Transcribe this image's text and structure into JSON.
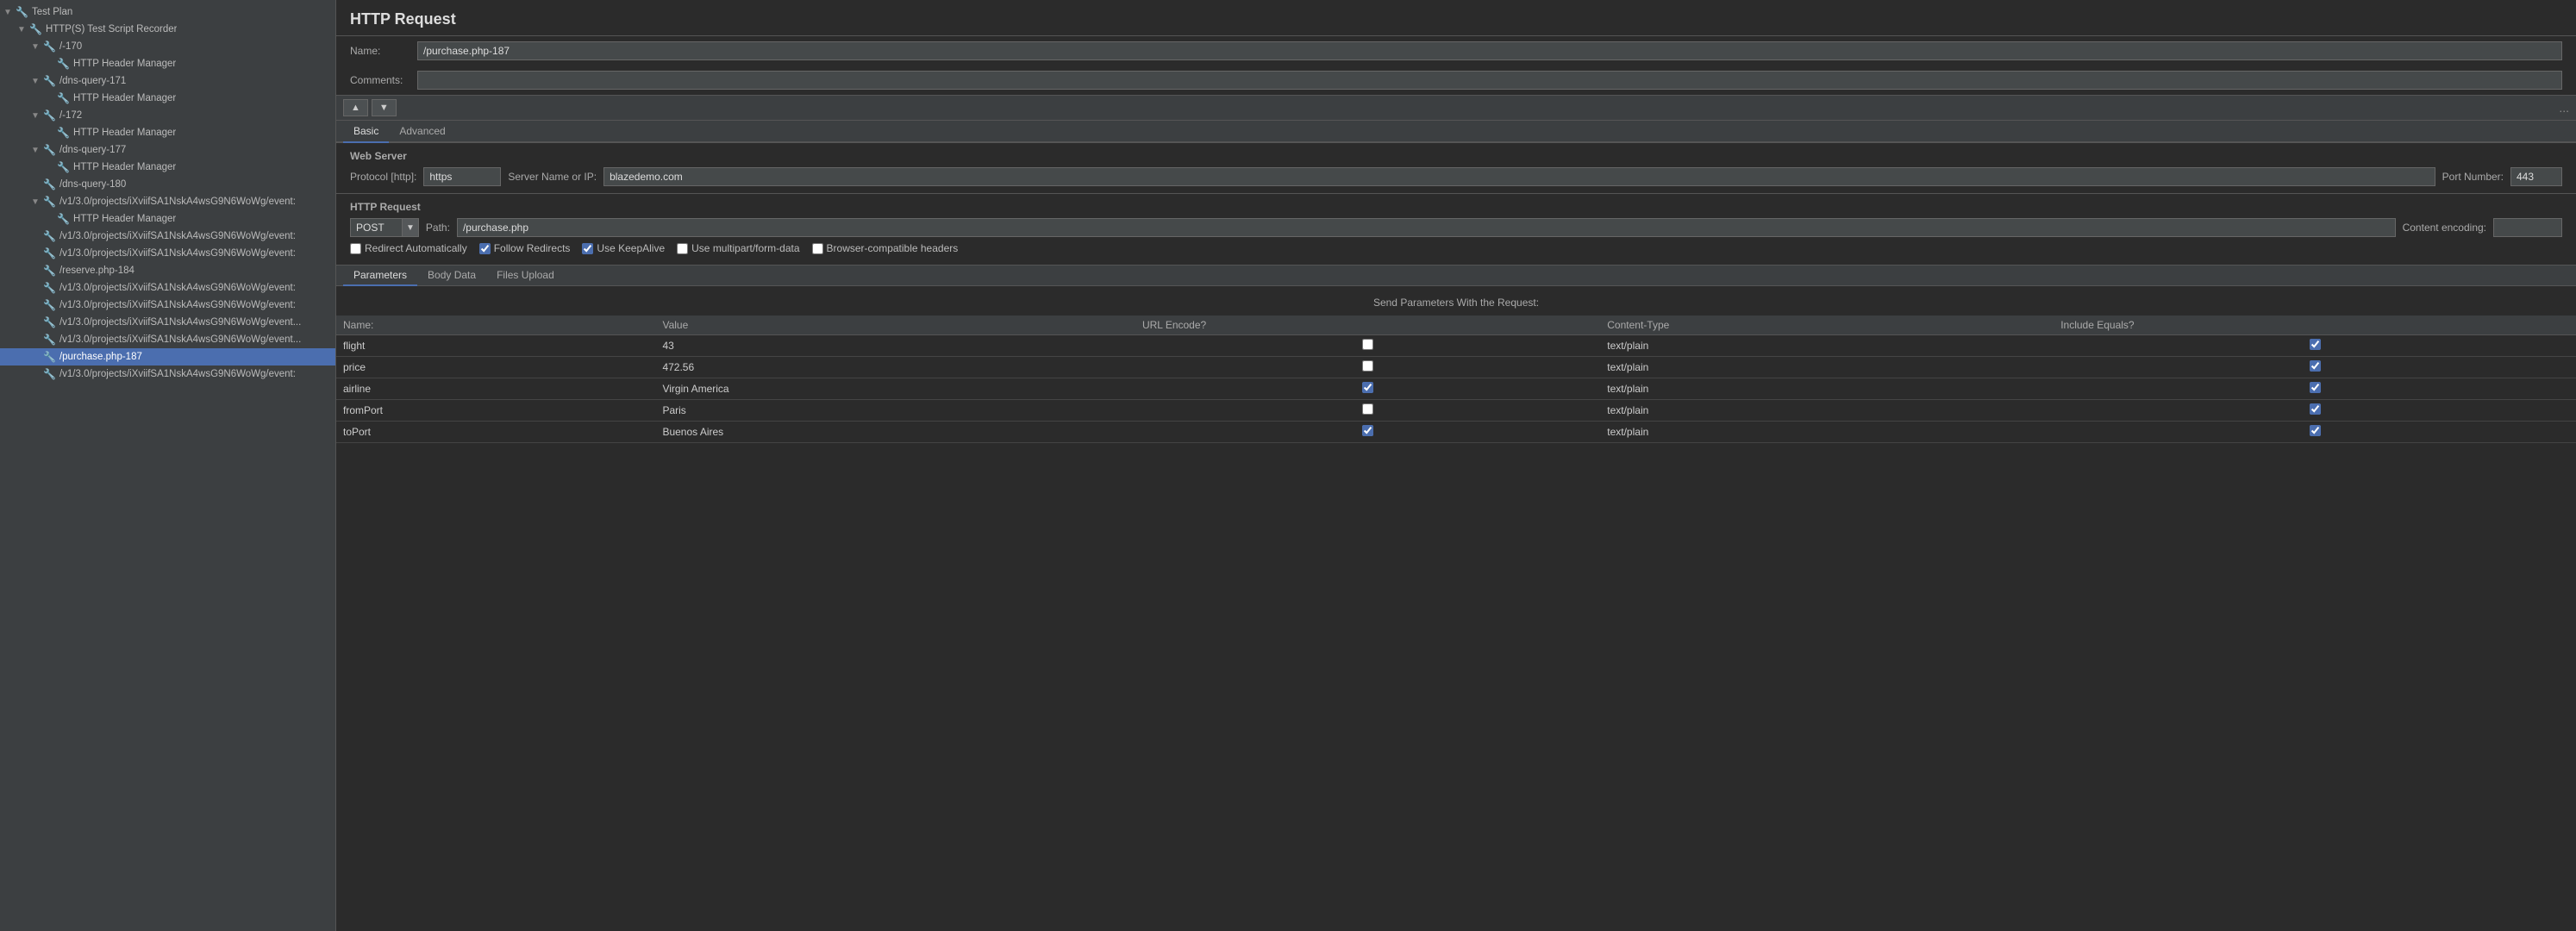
{
  "app": {
    "title": "HTTP Request",
    "name_label": "Name:",
    "comments_label": "Comments:",
    "name_value": "/purchase.php-187",
    "comments_value": ""
  },
  "toolbar": {
    "up_arrow": "▲",
    "down_arrow": "▼",
    "dots": "..."
  },
  "tabs": {
    "basic": "Basic",
    "advanced": "Advanced"
  },
  "web_server": {
    "title": "Web Server",
    "protocol_label": "Protocol [http]:",
    "protocol_value": "https",
    "server_label": "Server Name or IP:",
    "server_value": "blazedemo.com",
    "port_label": "Port Number:",
    "port_value": "443"
  },
  "http_request_section": {
    "title": "HTTP Request",
    "method": "POST",
    "path_label": "Path:",
    "path_value": "/purchase.php",
    "content_enc_label": "Content encoding:",
    "content_enc_value": ""
  },
  "checkboxes": {
    "redirect_auto_label": "Redirect Automatically",
    "redirect_auto_checked": false,
    "follow_redirects_label": "Follow Redirects",
    "follow_redirects_checked": true,
    "keepalive_label": "Use KeepAlive",
    "keepalive_checked": true,
    "multipart_label": "Use multipart/form-data",
    "multipart_checked": false,
    "browser_compat_label": "Browser-compatible headers",
    "browser_compat_checked": false
  },
  "sub_tabs": {
    "parameters": "Parameters",
    "body_data": "Body Data",
    "files_upload": "Files Upload"
  },
  "params_section": {
    "header": "Send Parameters With the Request:",
    "columns": {
      "name": "Name:",
      "value": "Value",
      "url_encode": "URL Encode?",
      "content_type": "Content-Type",
      "include_equals": "Include Equals?"
    },
    "rows": [
      {
        "name": "flight",
        "value": "43",
        "url_encode": false,
        "content_type": "text/plain",
        "include_equals": true
      },
      {
        "name": "price",
        "value": "472.56",
        "url_encode": false,
        "content_type": "text/plain",
        "include_equals": true
      },
      {
        "name": "airline",
        "value": "Virgin America",
        "url_encode": true,
        "content_type": "text/plain",
        "include_equals": true
      },
      {
        "name": "fromPort",
        "value": "Paris",
        "url_encode": false,
        "content_type": "text/plain",
        "include_equals": true
      },
      {
        "name": "toPort",
        "value": "Buenos Aires",
        "url_encode": true,
        "content_type": "text/plain",
        "include_equals": true
      }
    ]
  },
  "sidebar": {
    "items": [
      {
        "id": "test-plan",
        "label": "Test Plan",
        "depth": 0,
        "type": "root",
        "expanded": true,
        "icon": "▲"
      },
      {
        "id": "http-recorder",
        "label": "HTTP(S) Test Script Recorder",
        "depth": 1,
        "type": "recorder",
        "expanded": true,
        "icon": "🔧"
      },
      {
        "id": "item-170",
        "label": "/-170",
        "depth": 2,
        "type": "folder",
        "expanded": true,
        "icon": "🔧"
      },
      {
        "id": "item-170-header",
        "label": "HTTP Header Manager",
        "depth": 3,
        "type": "manager",
        "icon": "🔧"
      },
      {
        "id": "item-dns-171",
        "label": "/dns-query-171",
        "depth": 2,
        "type": "folder",
        "expanded": true,
        "icon": "🔧"
      },
      {
        "id": "item-dns-171-header",
        "label": "HTTP Header Manager",
        "depth": 3,
        "type": "manager",
        "icon": "🔧"
      },
      {
        "id": "item-172",
        "label": "/-172",
        "depth": 2,
        "type": "folder",
        "expanded": true,
        "icon": "🔧"
      },
      {
        "id": "item-172-header",
        "label": "HTTP Header Manager",
        "depth": 3,
        "type": "manager",
        "icon": "🔧"
      },
      {
        "id": "item-dns-177",
        "label": "/dns-query-177",
        "depth": 2,
        "type": "folder",
        "expanded": true,
        "icon": "🔧"
      },
      {
        "id": "item-dns-177-header",
        "label": "HTTP Header Manager",
        "depth": 3,
        "type": "manager",
        "icon": "🔧"
      },
      {
        "id": "item-dns-180",
        "label": "/dns-query-180",
        "depth": 2,
        "type": "leaf",
        "icon": "🔧"
      },
      {
        "id": "item-event1",
        "label": "/v1/3.0/projects/iXviifSA1NskA4wsG9N6WoWg/event:",
        "depth": 2,
        "type": "folder",
        "expanded": true,
        "icon": "🔧"
      },
      {
        "id": "item-event1-header",
        "label": "HTTP Header Manager",
        "depth": 3,
        "type": "manager",
        "icon": "🔧"
      },
      {
        "id": "item-event2",
        "label": "/v1/3.0/projects/iXviifSA1NskA4wsG9N6WoWg/event:",
        "depth": 2,
        "type": "leaf",
        "icon": "🔧"
      },
      {
        "id": "item-event3",
        "label": "/v1/3.0/projects/iXviifSA1NskA4wsG9N6WoWg/event:",
        "depth": 2,
        "type": "leaf",
        "icon": "🔧"
      },
      {
        "id": "item-reserve",
        "label": "/reserve.php-184",
        "depth": 2,
        "type": "leaf",
        "icon": "🔧"
      },
      {
        "id": "item-event4",
        "label": "/v1/3.0/projects/iXviifSA1NskA4wsG9N6WoWg/event:",
        "depth": 2,
        "type": "leaf",
        "icon": "🔧"
      },
      {
        "id": "item-event5",
        "label": "/v1/3.0/projects/iXviifSA1NskA4wsG9N6WoWg/event:",
        "depth": 2,
        "type": "leaf",
        "icon": "🔧"
      },
      {
        "id": "item-event6",
        "label": "/v1/3.0/projects/iXviifSA1NskA4wsG9N6WoWg/event...",
        "depth": 2,
        "type": "leaf",
        "icon": "🔧"
      },
      {
        "id": "item-event7",
        "label": "/v1/3.0/projects/iXviifSA1NskA4wsG9N6WoWg/event...",
        "depth": 2,
        "type": "leaf",
        "icon": "🔧"
      },
      {
        "id": "item-purchase",
        "label": "/purchase.php-187",
        "depth": 2,
        "type": "leaf",
        "selected": true,
        "icon": "🔧"
      },
      {
        "id": "item-event8",
        "label": "/v1/3.0/projects/iXviifSA1NskA4wsG9N6WoWg/event:",
        "depth": 2,
        "type": "leaf",
        "icon": "🔧"
      }
    ]
  }
}
